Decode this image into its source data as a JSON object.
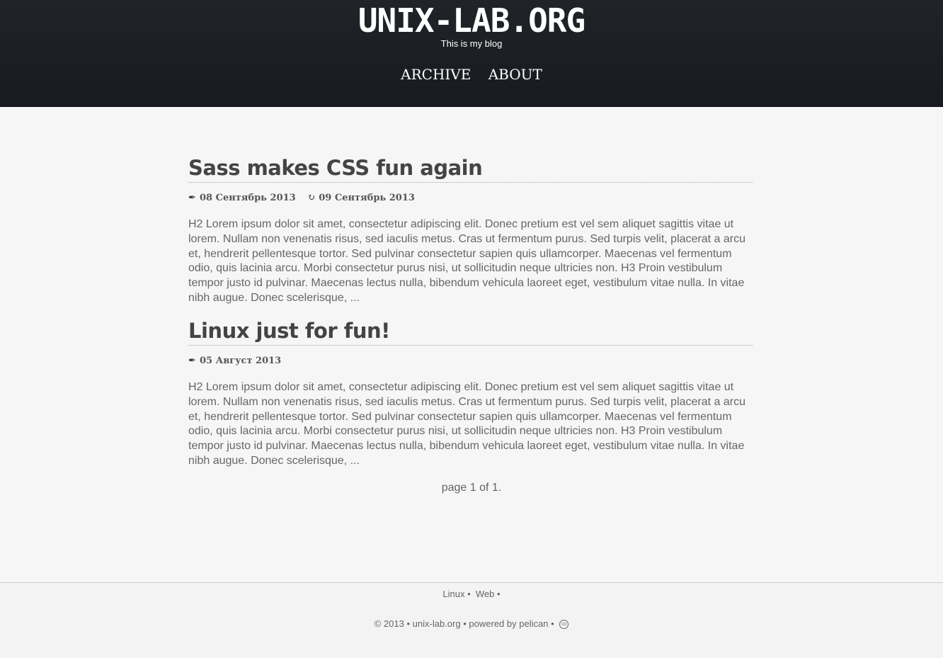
{
  "header": {
    "site_title": "UNIX-LAB.ORG",
    "tagline": "This is my blog",
    "nav": [
      "ARCHIVE",
      "ABOUT"
    ]
  },
  "posts": [
    {
      "title": "Sass makes CSS fun again",
      "published": "08 Сентябрь 2013",
      "modified": "09 Сентябрь 2013",
      "excerpt": "H2 Lorem ipsum dolor sit amet, consectetur adipiscing elit. Donec pretium est vel sem aliquet sagittis vitae ut lorem. Nullam non venenatis risus, sed iaculis metus. Cras ut fermentum purus. Sed turpis velit, placerat a arcu et, hendrerit pellentesque tortor. Sed pulvinar consectetur sapien quis ullamcorper. Maecenas vel fermentum odio, quis lacinia arcu. Morbi consectetur purus nisi, ut sollicitudin neque ultricies non. H3 Proin vestibulum tempor justo id pulvinar. Maecenas lectus nulla, bibendum vehicula laoreet eget, vestibulum vitae nulla. In vitae nibh augue. Donec scelerisque, ..."
    },
    {
      "title": "Linux just for fun!",
      "published": "05 Август 2013",
      "excerpt": "H2 Lorem ipsum dolor sit amet, consectetur adipiscing elit. Donec pretium est vel sem aliquet sagittis vitae ut lorem. Nullam non venenatis risus, sed iaculis metus. Cras ut fermentum purus. Sed turpis velit, placerat a arcu et, hendrerit pellentesque tortor. Sed pulvinar consectetur sapien quis ullamcorper. Maecenas vel fermentum odio, quis lacinia arcu. Morbi consectetur purus nisi, ut sollicitudin neque ultricies non. H3 Proin vestibulum tempor justo id pulvinar. Maecenas lectus nulla, bibendum vehicula laoreet eget, vestibulum vitae nulla. In vitae nibh augue. Donec scelerisque, ..."
    }
  ],
  "pager": "page 1 of 1.",
  "footer": {
    "categories": [
      "Linux",
      "Web"
    ],
    "separator": "•",
    "copyright": "© 2013",
    "site": "unix-lab.org",
    "powered": "powered by pelican",
    "license_icon": "creative-commons-icon",
    "license_icon_glyph": "cc"
  },
  "icons": {
    "published": "quill-icon",
    "modified": "refresh-icon"
  }
}
